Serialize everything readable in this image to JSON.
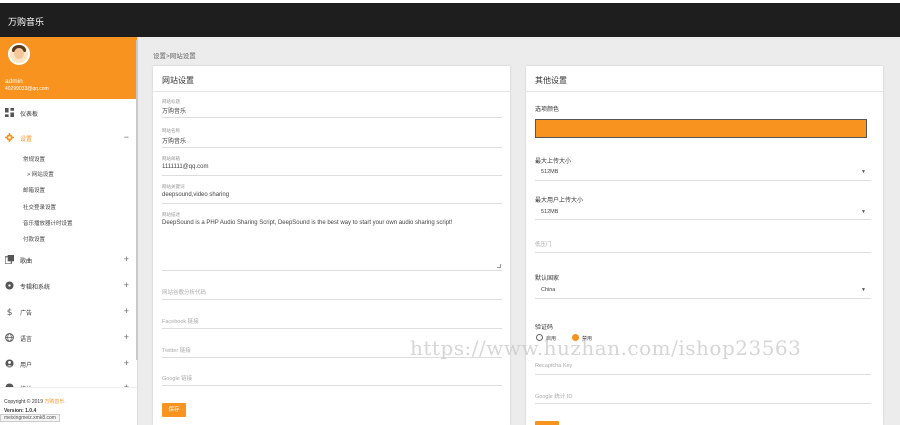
{
  "app": {
    "brand": "万购音乐"
  },
  "breadcrumb": "设置>网站设置",
  "profile": {
    "name": "admin",
    "email": "40299033@qq.com"
  },
  "sidebar": {
    "items": [
      {
        "label": "仪表板",
        "icon": "dashboard-icon",
        "expander": ""
      },
      {
        "label": "设置",
        "icon": "gear-icon",
        "expander": "−"
      },
      {
        "label": "歌曲",
        "icon": "music-library-icon",
        "expander": "+"
      },
      {
        "label": "专辑和系统",
        "icon": "disc-icon",
        "expander": "+"
      },
      {
        "label": "广告",
        "icon": "dollar-icon",
        "expander": "+"
      },
      {
        "label": "语言",
        "icon": "globe-icon",
        "expander": "+"
      },
      {
        "label": "用户",
        "icon": "user-icon",
        "expander": "+"
      },
      {
        "label": "统计",
        "icon": "chart-icon",
        "expander": "+"
      }
    ],
    "subitems": [
      "常规设置",
      "> 网站设置",
      "邮箱设置",
      "社交登录设置",
      "音乐播放器计时设置",
      "付款设置"
    ]
  },
  "footer": {
    "copyright_prefix": "Copyright © 2019 ",
    "copyright_brand": "万购音乐.",
    "version": "Version: 1.0.4",
    "host": "meixingmeiz.xmk8.com"
  },
  "site_settings": {
    "title": "网站设置",
    "fields": [
      {
        "label": "网站标题",
        "value": "万购音乐"
      },
      {
        "label": "网站名称",
        "value": "万购音乐"
      },
      {
        "label": "网站邮箱",
        "value": "1111111@qq.com"
      },
      {
        "label": "网站关键词",
        "value": "deepsound,video sharing"
      },
      {
        "label": "网站描述",
        "value": "DeepSound is a PHP Audio Sharing Script, DeepSound is the best way to start your own audio sharing script!"
      }
    ],
    "placeholders": [
      "网站谷歌分析代码",
      "Facebook 链接",
      "Twitter 链接",
      "Google 链接"
    ],
    "save_label": "保存"
  },
  "other_settings": {
    "title": "其他设置",
    "theme_color_label": "选项颜色",
    "theme_color": "#f7931e",
    "max_upload_label": "最大上传大小",
    "max_upload_value": "512MB",
    "max_user_upload_label": "最大用户上传大小",
    "max_user_upload_value": "512MB",
    "field_placeholder": "低压门",
    "default_country_label": "默认国家",
    "default_country_value": "China",
    "captcha_label": "验证码",
    "captcha_options": [
      "启用",
      "禁用"
    ],
    "captcha_selected": 1,
    "recaptcha_placeholder": "Recaptcha Key",
    "google_analytics_placeholder": "Google 统计 ID"
  },
  "watermark": "https://www.huzhan.com/ishop23563"
}
